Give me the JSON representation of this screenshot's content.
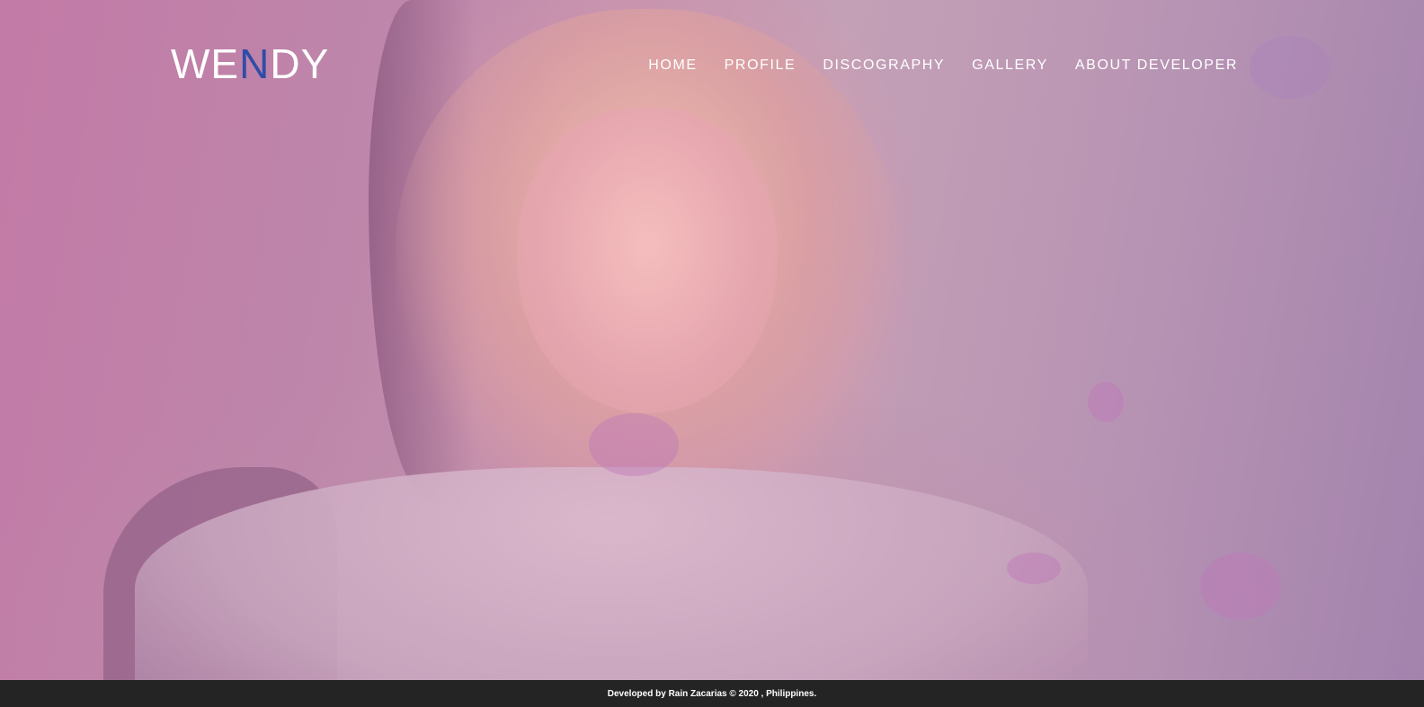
{
  "logo": {
    "before": "WE",
    "accent": "N",
    "after": "DY"
  },
  "nav": {
    "items": [
      {
        "label": "HOME"
      },
      {
        "label": "PROFILE"
      },
      {
        "label": "DISCOGRAPHY"
      },
      {
        "label": "GALLERY"
      },
      {
        "label": "ABOUT DEVELOPER"
      }
    ]
  },
  "footer": {
    "text": "Developed by Rain Zacarias © 2020 , Philippines."
  },
  "colors": {
    "logo_accent": "#2f4da8",
    "footer_bg": "#242424",
    "overlay_tint": "#b88aa6"
  }
}
